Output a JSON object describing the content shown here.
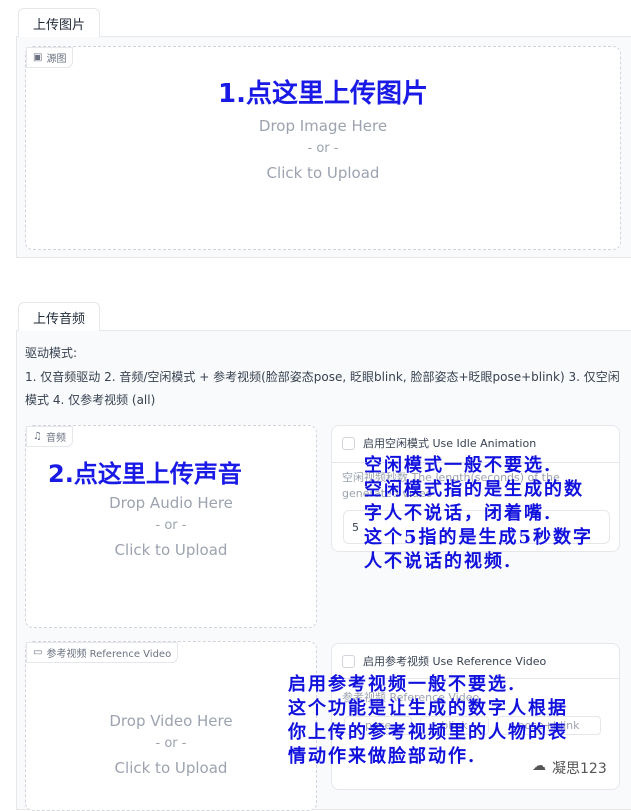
{
  "tabs": {
    "image": "上传图片",
    "audio": "上传音频"
  },
  "image_upload": {
    "label": "源图",
    "annotation": "1.点这里上传图片",
    "drop": "Drop Image Here",
    "or": "- or -",
    "click": "Click to Upload"
  },
  "drive_mode": {
    "title": "驱动模式:",
    "description": "1. 仅音频驱动 2. 音频/空闲模式 + 参考视频(脸部姿态pose, 眨眼blink, 脸部姿态+眨眼pose+blink) 3. 仅空闲模式 4. 仅参考视频 (all)"
  },
  "audio_upload": {
    "label": "音频",
    "annotation": "2.点这里上传声音",
    "drop": "Drop Audio Here",
    "or": "- or -",
    "click": "Click to Upload"
  },
  "idle": {
    "checkbox_label": "启用空闲模式 Use Idle Animation",
    "field_label": "空闲视频秒数 The length(seconds) of the generated video",
    "value": "5",
    "annotation": [
      "空闲模式一般不要选.",
      "空闲模式指的是生成的数",
      "字人不说话，闭着嘴.",
      "这个5指的是生成5秒数字",
      "人不说话的视频."
    ]
  },
  "video_upload": {
    "label": "参考视频 Reference Video",
    "drop": "Drop Video Here",
    "or": "- or -",
    "click": "Click to Upload"
  },
  "reference": {
    "checkbox_label": "启用参考视频 Use Reference Video",
    "field_label": "参考视频 Reference Video",
    "options": [
      "pose",
      "blink",
      "pose+blink"
    ],
    "annotation": [
      "启用参考视频一般不要选.",
      "这个功能是让生成的数字人根据",
      "你上传的参考视频里的人物的表",
      "情动作来做脸部动作."
    ]
  },
  "watermark": "凝思123",
  "colors": {
    "annotation": "#1111dd",
    "accent": "#2563eb"
  }
}
